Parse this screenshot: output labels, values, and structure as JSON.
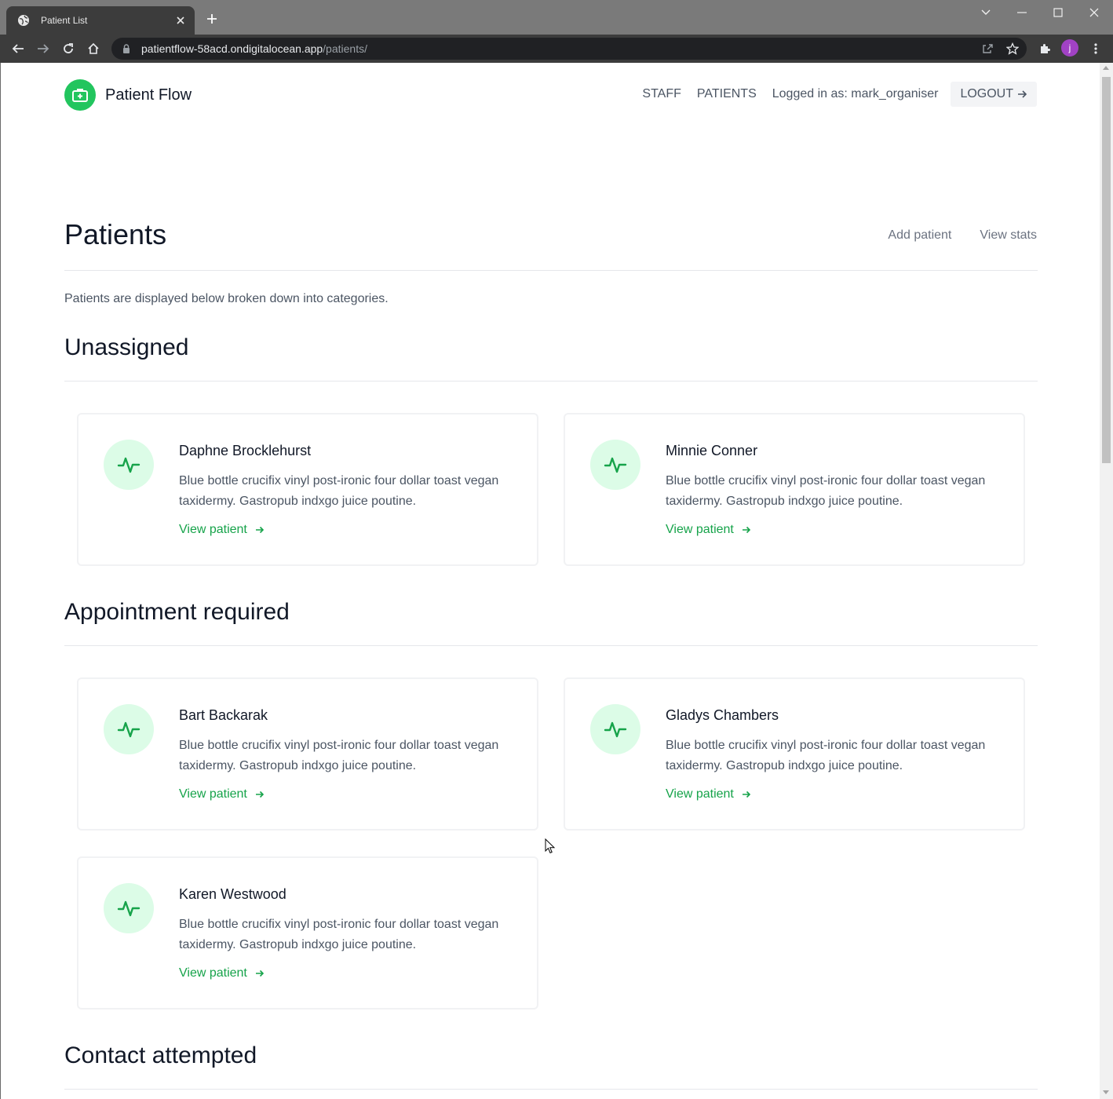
{
  "browser": {
    "tab_title": "Patient List",
    "url_host": "patientflow-58acd.ondigitalocean.app",
    "url_path": "/patients/",
    "profile_initial": "j"
  },
  "header": {
    "brand": "Patient Flow",
    "nav": {
      "staff": "STAFF",
      "patients": "PATIENTS",
      "logged_in": "Logged in as: mark_organiser",
      "logout": "LOGOUT"
    }
  },
  "page": {
    "title": "Patients",
    "add_patient": "Add patient",
    "view_stats": "View stats",
    "intro": "Patients are displayed below broken down into categories."
  },
  "sections": [
    {
      "title": "Unassigned",
      "patients": [
        {
          "name": "Daphne Brocklehurst",
          "desc": "Blue bottle crucifix vinyl post-ironic four dollar toast vegan taxidermy. Gastropub indxgo juice poutine.",
          "link": "View patient"
        },
        {
          "name": "Minnie Conner",
          "desc": "Blue bottle crucifix vinyl post-ironic four dollar toast vegan taxidermy. Gastropub indxgo juice poutine.",
          "link": "View patient"
        }
      ]
    },
    {
      "title": "Appointment required",
      "patients": [
        {
          "name": "Bart Backarak",
          "desc": "Blue bottle crucifix vinyl post-ironic four dollar toast vegan taxidermy. Gastropub indxgo juice poutine.",
          "link": "View patient"
        },
        {
          "name": "Gladys Chambers",
          "desc": "Blue bottle crucifix vinyl post-ironic four dollar toast vegan taxidermy. Gastropub indxgo juice poutine.",
          "link": "View patient"
        },
        {
          "name": "Karen Westwood",
          "desc": "Blue bottle crucifix vinyl post-ironic four dollar toast vegan taxidermy. Gastropub indxgo juice poutine.",
          "link": "View patient"
        }
      ]
    },
    {
      "title": "Contact attempted",
      "patients": []
    }
  ],
  "colors": {
    "accent": "#22c55e",
    "link": "#16a34a",
    "icon_bg": "#dcfce7"
  },
  "icons": {
    "brand": "medical-kit-icon",
    "patient": "activity-pulse-icon",
    "arrow": "arrow-right-icon"
  }
}
